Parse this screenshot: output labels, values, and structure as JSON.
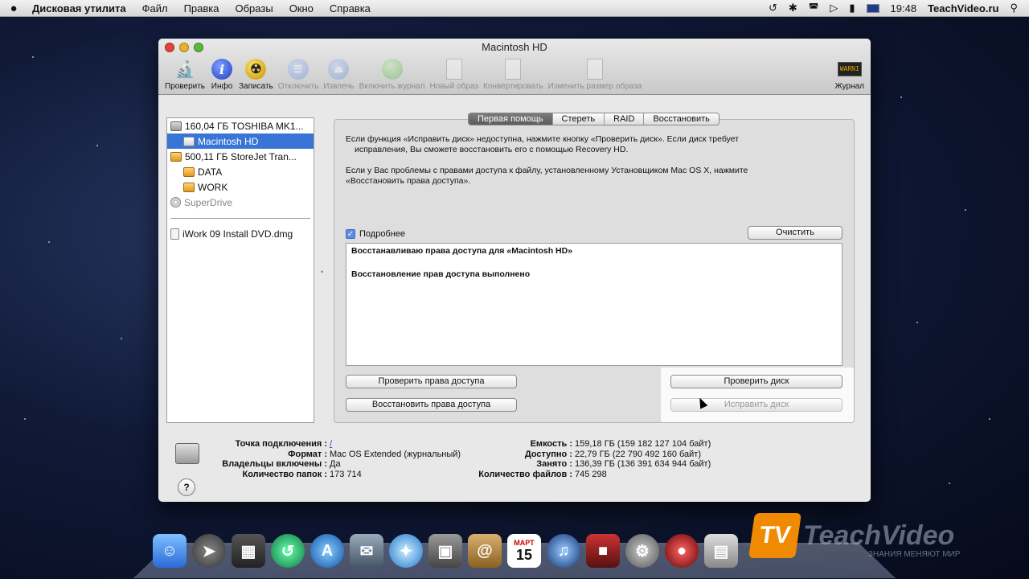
{
  "menubar": {
    "apple": "",
    "app_name": "Дисковая утилита",
    "items": [
      "Файл",
      "Правка",
      "Образы",
      "Окно",
      "Справка"
    ],
    "time": "19:48",
    "site": "TeachVideo.ru"
  },
  "window": {
    "title": "Macintosh HD",
    "toolbar": [
      {
        "label": "Проверить",
        "icon": "microscope-icon",
        "enabled": true
      },
      {
        "label": "Инфо",
        "icon": "info-icon",
        "enabled": true
      },
      {
        "label": "Записать",
        "icon": "burn-icon",
        "enabled": true
      },
      {
        "label": "Отключить",
        "icon": "unmount-icon",
        "enabled": false
      },
      {
        "label": "Извлечь",
        "icon": "eject-icon",
        "enabled": false
      },
      {
        "label": "Включить журнал",
        "icon": "journal-icon",
        "enabled": false
      },
      {
        "label": "Новый образ",
        "icon": "new-image-icon",
        "enabled": false
      },
      {
        "label": "Конвертировать",
        "icon": "convert-icon",
        "enabled": false
      },
      {
        "label": "Изменить размер образа",
        "icon": "resize-image-icon",
        "enabled": false
      }
    ],
    "log_button": "Журнал",
    "log_icon_text": "WARNI"
  },
  "sidebar": {
    "items": [
      {
        "label": "160,04 ГБ TOSHIBA MK1...",
        "icon": "hard-disk-icon",
        "level": 0
      },
      {
        "label": "Macintosh HD",
        "icon": "volume-icon",
        "level": 1,
        "selected": true
      },
      {
        "label": "500,11 ГБ StoreJet Tran...",
        "icon": "external-disk-icon",
        "level": 0
      },
      {
        "label": "DATA",
        "icon": "external-volume-icon",
        "level": 1
      },
      {
        "label": "WORK",
        "icon": "external-volume-icon",
        "level": 1
      },
      {
        "label": "SuperDrive",
        "icon": "optical-drive-icon",
        "level": 0,
        "dim": true
      }
    ],
    "images": [
      {
        "label": "iWork 09 Install DVD.dmg",
        "icon": "dmg-icon"
      }
    ]
  },
  "tabs": [
    "Первая помощь",
    "Стереть",
    "RAID",
    "Восстановить"
  ],
  "first_aid": {
    "paragraph1_line1": "Если функция «Исправить диск» недоступна, нажмите кнопку «Проверить диск». Если диск требует",
    "paragraph1_line2": "исправления, Вы сможете восстановить его с помощью Recovery HD.",
    "paragraph2_line1": "Если у Вас проблемы с правами доступа к файлу, установленному Установщиком Mac OS X, нажмите",
    "paragraph2_line2": "«Восстановить права доступа».",
    "details_label": "Подробнее",
    "details_checked": true,
    "clear_button": "Очистить",
    "log_lines": [
      "Восстанавливаю права доступа для «Macintosh HD»",
      "Восстановление прав доступа выполнено"
    ],
    "verify_permissions": "Проверить права доступа",
    "repair_permissions": "Восстановить права доступа",
    "verify_disk": "Проверить диск",
    "repair_disk": "Исправить диск"
  },
  "info": {
    "left": [
      {
        "key": "Точка подключения :",
        "value": "/"
      },
      {
        "key": "Формат :",
        "value": "Mac OS Extended (журнальный)"
      },
      {
        "key": "Владельцы включены :",
        "value": "Да"
      },
      {
        "key": "Количество папок :",
        "value": "173 714"
      }
    ],
    "right": [
      {
        "key": "Емкость :",
        "value": "159,18 ГБ (159 182 127 104 байт)"
      },
      {
        "key": "Доступно :",
        "value": "22,79 ГБ (22 790 492 160 байт)"
      },
      {
        "key": "Занято :",
        "value": "136,39 ГБ (136 391 634 944 байт)"
      },
      {
        "key": "Количество файлов :",
        "value": "745 298"
      }
    ],
    "help": "?"
  },
  "dock": {
    "calendar_month": "МАРТ",
    "calendar_day": "15"
  },
  "watermark": {
    "logo": "TV",
    "text": "TeachVideo",
    "subtitle": "ЗНАНИЯ МЕНЯЮТ МИР"
  }
}
